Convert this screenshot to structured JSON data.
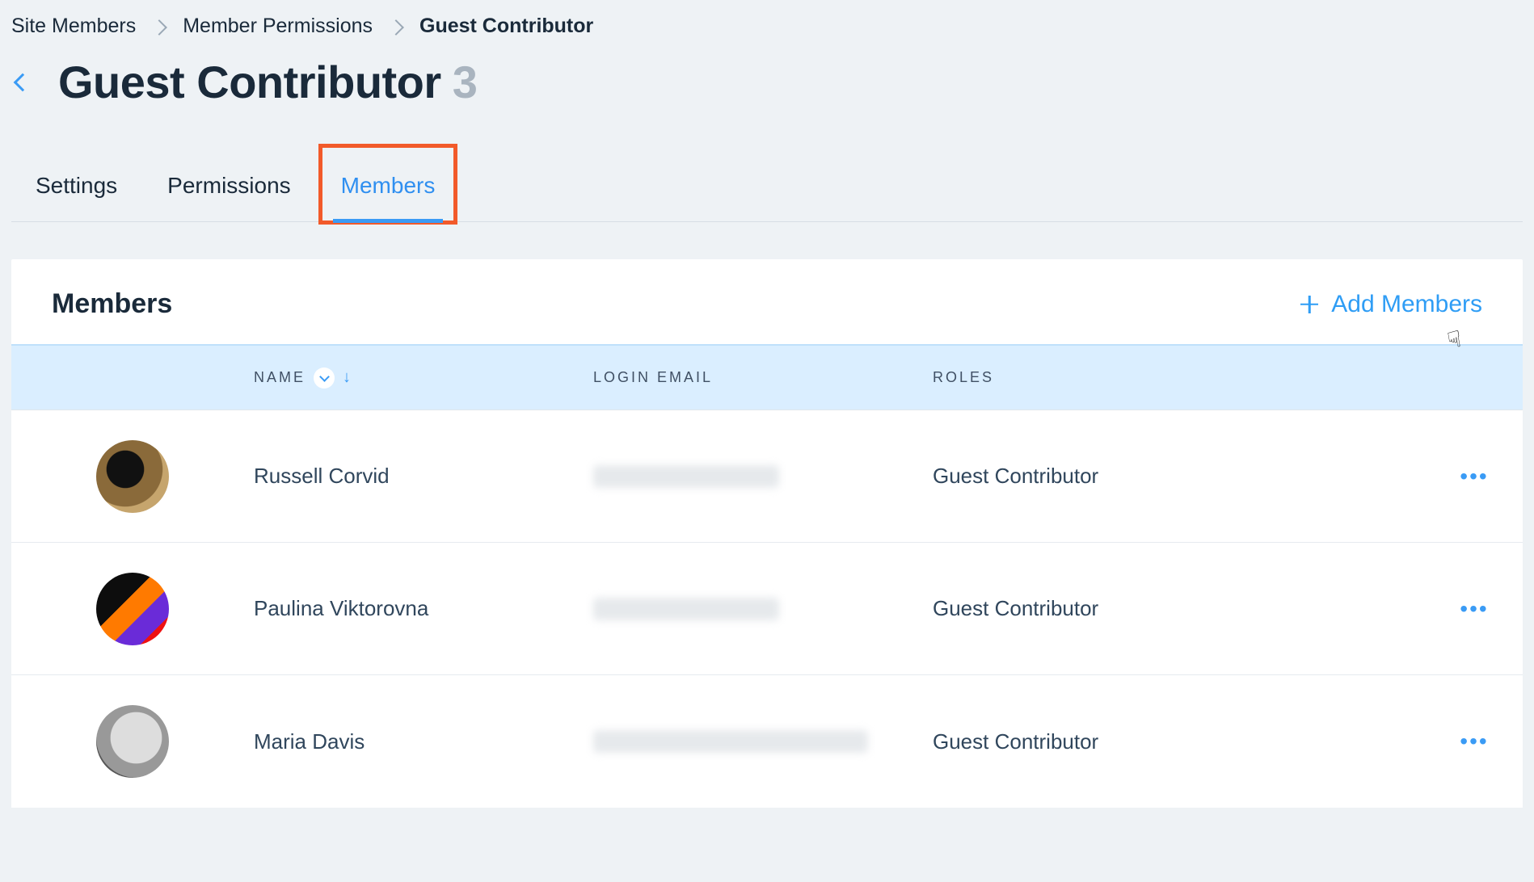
{
  "breadcrumb": {
    "items": [
      "Site Members",
      "Member Permissions",
      "Guest Contributor"
    ]
  },
  "page": {
    "title": "Guest Contributor",
    "count": "3"
  },
  "tabs": [
    {
      "label": "Settings",
      "active": false
    },
    {
      "label": "Permissions",
      "active": false
    },
    {
      "label": "Members",
      "active": true
    }
  ],
  "card": {
    "heading": "Members",
    "add_label": "Add Members"
  },
  "table": {
    "columns": {
      "name": "NAME",
      "email": "LOGIN EMAIL",
      "roles": "ROLES"
    },
    "rows": [
      {
        "name": "Russell Corvid",
        "role": "Guest Contributor"
      },
      {
        "name": "Paulina Viktorovna",
        "role": "Guest Contributor"
      },
      {
        "name": "Maria Davis",
        "role": "Guest Contributor"
      }
    ]
  }
}
